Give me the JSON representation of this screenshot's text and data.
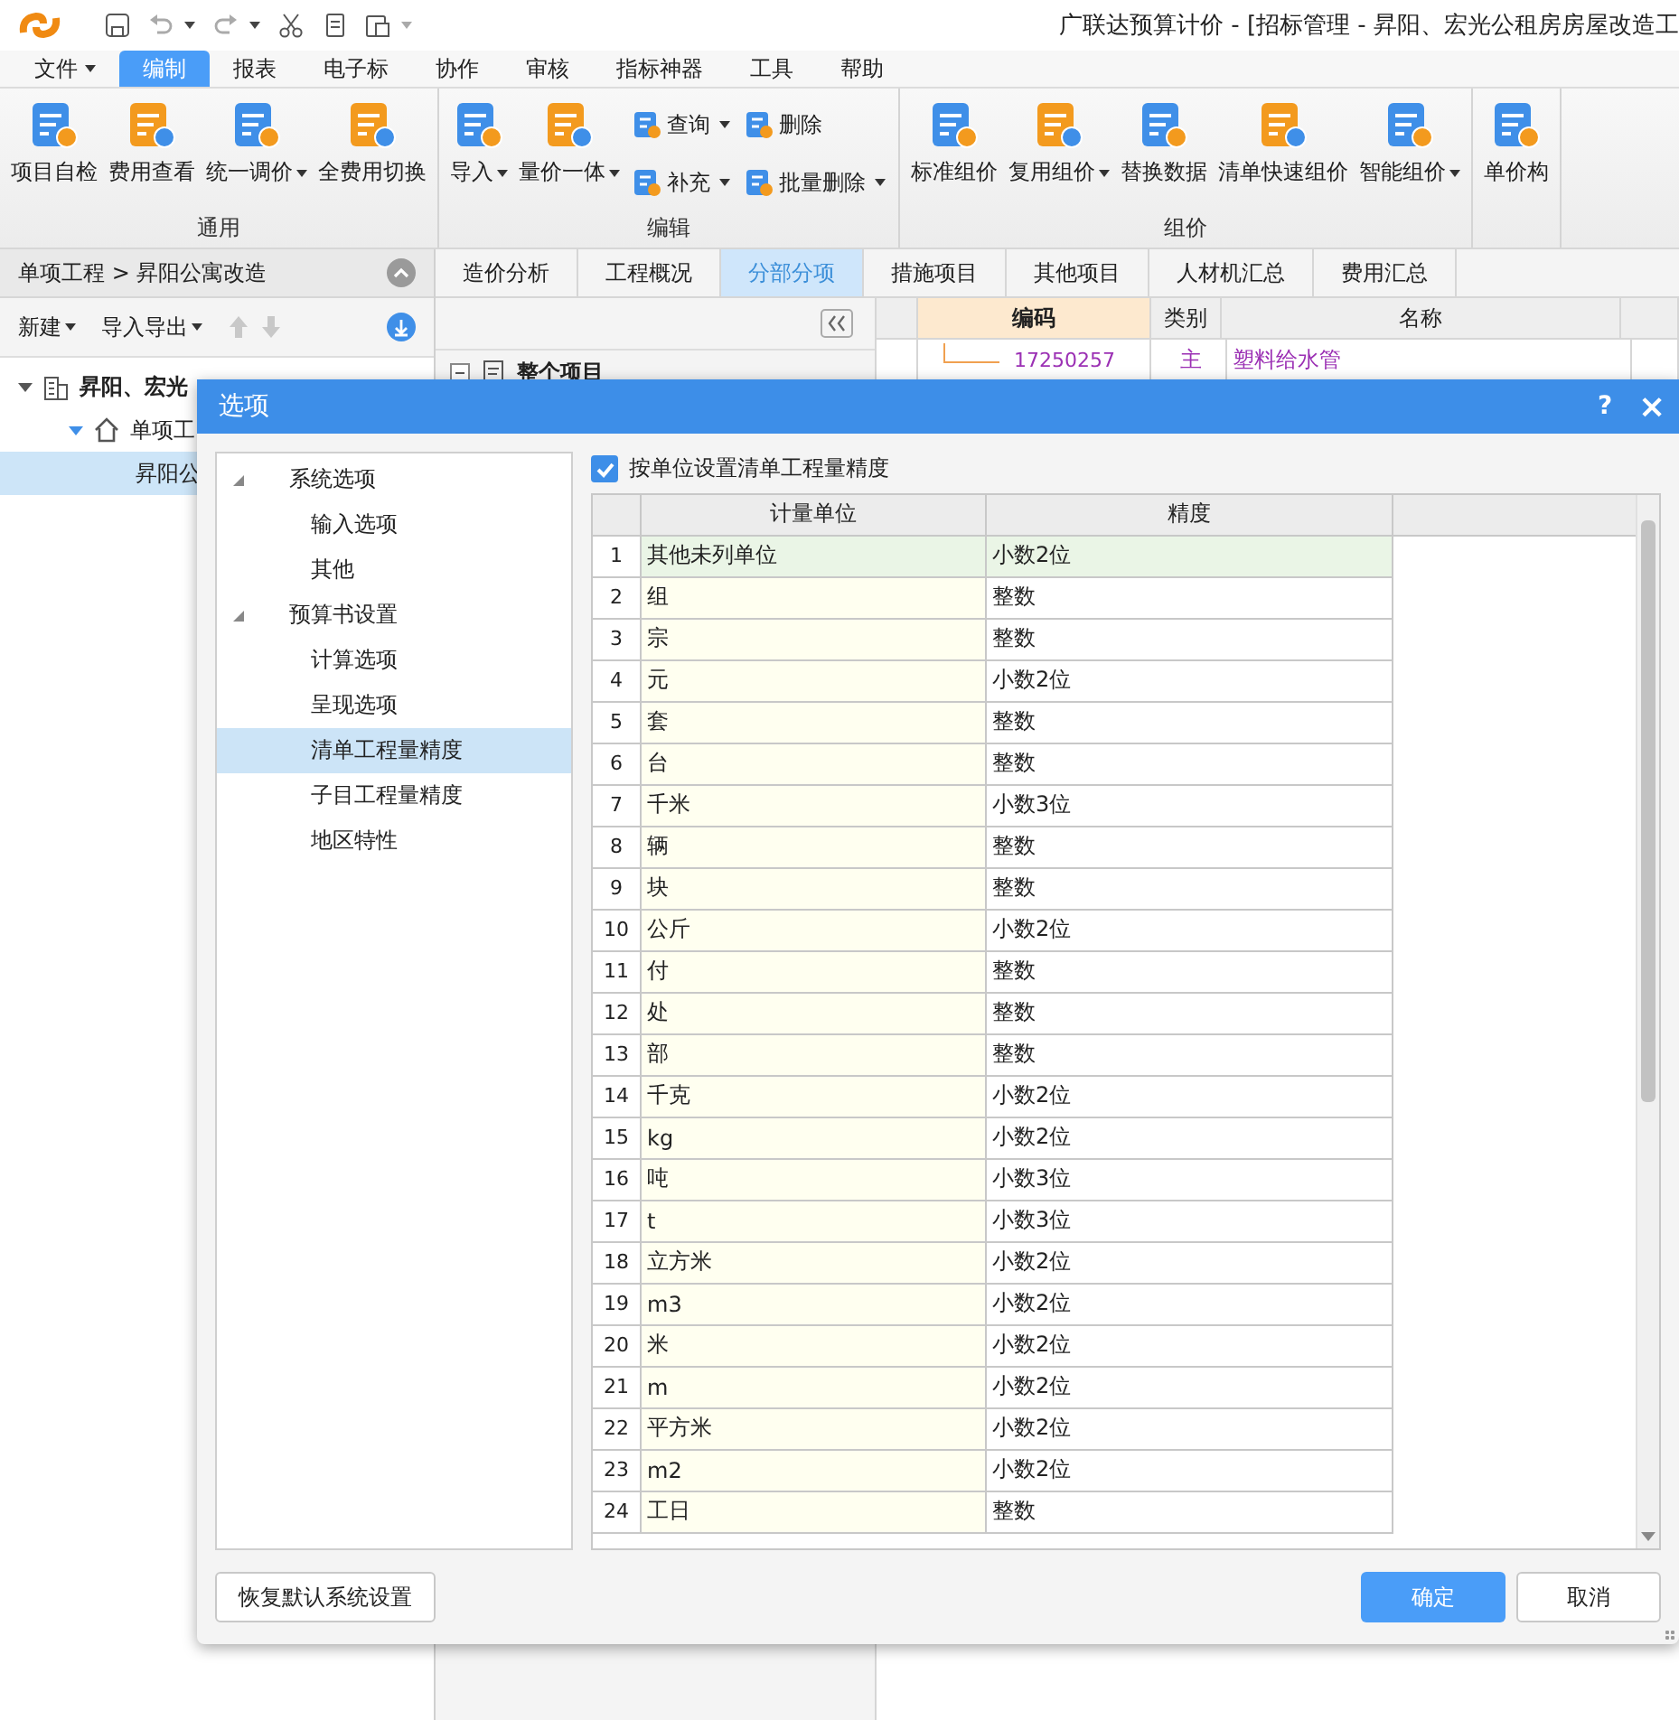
{
  "app": {
    "title": "广联达预算计价 - [招标管理 - 昇阳、宏光公租房房屋改造工"
  },
  "menu": [
    {
      "label": "文件",
      "selected": false,
      "dropdown": true
    },
    {
      "label": "编制",
      "selected": true,
      "dropdown": false
    },
    {
      "label": "报表",
      "selected": false,
      "dropdown": false
    },
    {
      "label": "电子标",
      "selected": false,
      "dropdown": false
    },
    {
      "label": "协作",
      "selected": false,
      "dropdown": false
    },
    {
      "label": "审核",
      "selected": false,
      "dropdown": false
    },
    {
      "label": "指标神器",
      "selected": false,
      "dropdown": false
    },
    {
      "label": "工具",
      "selected": false,
      "dropdown": false
    },
    {
      "label": "帮助",
      "selected": false,
      "dropdown": false
    }
  ],
  "ribbon": {
    "groups": [
      {
        "label": "通用",
        "items": [
          {
            "kind": "large",
            "label": "项目自检",
            "dropdown": false
          },
          {
            "kind": "large",
            "label": "费用查看",
            "dropdown": false
          },
          {
            "kind": "large",
            "label": "统一调价",
            "dropdown": true
          },
          {
            "kind": "large",
            "label": "全费用切换",
            "dropdown": false
          }
        ]
      },
      {
        "label": "编辑",
        "items": [
          {
            "kind": "large",
            "label": "导入",
            "dropdown": true
          },
          {
            "kind": "large",
            "label": "量价一体",
            "dropdown": true
          },
          {
            "kind": "small",
            "label": "查询",
            "dropdown": true
          },
          {
            "kind": "small",
            "label": "补充",
            "dropdown": true
          },
          {
            "kind": "small",
            "label": "删除",
            "dropdown": false
          },
          {
            "kind": "small",
            "label": "批量删除",
            "dropdown": true
          }
        ]
      },
      {
        "label": "组价",
        "items": [
          {
            "kind": "large",
            "label": "标准组价",
            "dropdown": false
          },
          {
            "kind": "large",
            "label": "复用组价",
            "dropdown": true
          },
          {
            "kind": "large",
            "label": "替换数据",
            "dropdown": false
          },
          {
            "kind": "large",
            "label": "清单快速组价",
            "dropdown": false
          },
          {
            "kind": "large",
            "label": "智能组价",
            "dropdown": true
          }
        ]
      },
      {
        "items": [
          {
            "kind": "large",
            "label": "单价构",
            "dropdown": false
          }
        ]
      }
    ]
  },
  "left_panel": {
    "breadcrumb": "单项工程 > 昇阳公寓改造",
    "toolbar": [
      {
        "label": "新建",
        "dropdown": true
      },
      {
        "label": "导入导出",
        "dropdown": true
      }
    ],
    "tree": [
      {
        "label": "昇阳、宏光",
        "expanded": true,
        "children": [
          {
            "label": "单项工",
            "expanded": true,
            "children": [
              {
                "label": "昇阳公",
                "selected": true
              }
            ]
          }
        ]
      }
    ]
  },
  "tabs": [
    {
      "label": "造价分析",
      "selected": false
    },
    {
      "label": "工程概况",
      "selected": false
    },
    {
      "label": "分部分项",
      "selected": true
    },
    {
      "label": "措施项目",
      "selected": false
    },
    {
      "label": "其他项目",
      "selected": false
    },
    {
      "label": "人材机汇总",
      "selected": false
    },
    {
      "label": "费用汇总",
      "selected": false
    }
  ],
  "outline": {
    "root": {
      "label": "整个项目",
      "expanded": true
    }
  },
  "grid": {
    "columns": [
      "编码",
      "类别",
      "名称"
    ],
    "rows": [
      {
        "code": "17250257",
        "type": "主",
        "name": "塑料给水管"
      }
    ]
  },
  "dialog": {
    "title": "选项",
    "help": "?",
    "close": "×",
    "tree": [
      {
        "label": "系统选项",
        "expanded": true,
        "selected": false,
        "children": [
          {
            "label": "输入选项",
            "selected": false
          },
          {
            "label": "其他",
            "selected": false
          }
        ]
      },
      {
        "label": "预算书设置",
        "expanded": true,
        "selected": false,
        "children": [
          {
            "label": "计算选项",
            "selected": false
          },
          {
            "label": "呈现选项",
            "selected": false
          },
          {
            "label": "清单工程量精度",
            "selected": true
          },
          {
            "label": "子目工程量精度",
            "selected": false
          },
          {
            "label": "地区特性",
            "selected": false
          }
        ]
      }
    ],
    "checkbox": {
      "label": "按单位设置清单工程量精度",
      "checked": true
    },
    "table": {
      "columns": [
        "计量单位",
        "精度"
      ],
      "rows": [
        {
          "no": "1",
          "unit": "其他未列单位",
          "precision": "小数2位",
          "selected": true
        },
        {
          "no": "2",
          "unit": "组",
          "precision": "整数",
          "selected": false
        },
        {
          "no": "3",
          "unit": "宗",
          "precision": "整数",
          "selected": false
        },
        {
          "no": "4",
          "unit": "元",
          "precision": "小数2位",
          "selected": false
        },
        {
          "no": "5",
          "unit": "套",
          "precision": "整数",
          "selected": false
        },
        {
          "no": "6",
          "unit": "台",
          "precision": "整数",
          "selected": false
        },
        {
          "no": "7",
          "unit": "千米",
          "precision": "小数3位",
          "selected": false
        },
        {
          "no": "8",
          "unit": "辆",
          "precision": "整数",
          "selected": false
        },
        {
          "no": "9",
          "unit": "块",
          "precision": "整数",
          "selected": false
        },
        {
          "no": "10",
          "unit": "公斤",
          "precision": "小数2位",
          "selected": false
        },
        {
          "no": "11",
          "unit": "付",
          "precision": "整数",
          "selected": false
        },
        {
          "no": "12",
          "unit": "处",
          "precision": "整数",
          "selected": false
        },
        {
          "no": "13",
          "unit": "部",
          "precision": "整数",
          "selected": false
        },
        {
          "no": "14",
          "unit": "千克",
          "precision": "小数2位",
          "selected": false
        },
        {
          "no": "15",
          "unit": "kg",
          "precision": "小数2位",
          "selected": false
        },
        {
          "no": "16",
          "unit": "吨",
          "precision": "小数3位",
          "selected": false
        },
        {
          "no": "17",
          "unit": "t",
          "precision": "小数3位",
          "selected": false
        },
        {
          "no": "18",
          "unit": "立方米",
          "precision": "小数2位",
          "selected": false
        },
        {
          "no": "19",
          "unit": "m3",
          "precision": "小数2位",
          "selected": false
        },
        {
          "no": "20",
          "unit": "米",
          "precision": "小数2位",
          "selected": false
        },
        {
          "no": "21",
          "unit": "m",
          "precision": "小数2位",
          "selected": false
        },
        {
          "no": "22",
          "unit": "平方米",
          "precision": "小数2位",
          "selected": false
        },
        {
          "no": "23",
          "unit": "m2",
          "precision": "小数2位",
          "selected": false
        },
        {
          "no": "24",
          "unit": "工日",
          "precision": "整数",
          "selected": false
        }
      ]
    },
    "buttons": [
      {
        "kind": "secondary",
        "label": "恢复默认系统设置"
      },
      {
        "kind": "primary",
        "label": "确定"
      },
      {
        "kind": "secondary",
        "label": "取消"
      }
    ]
  }
}
